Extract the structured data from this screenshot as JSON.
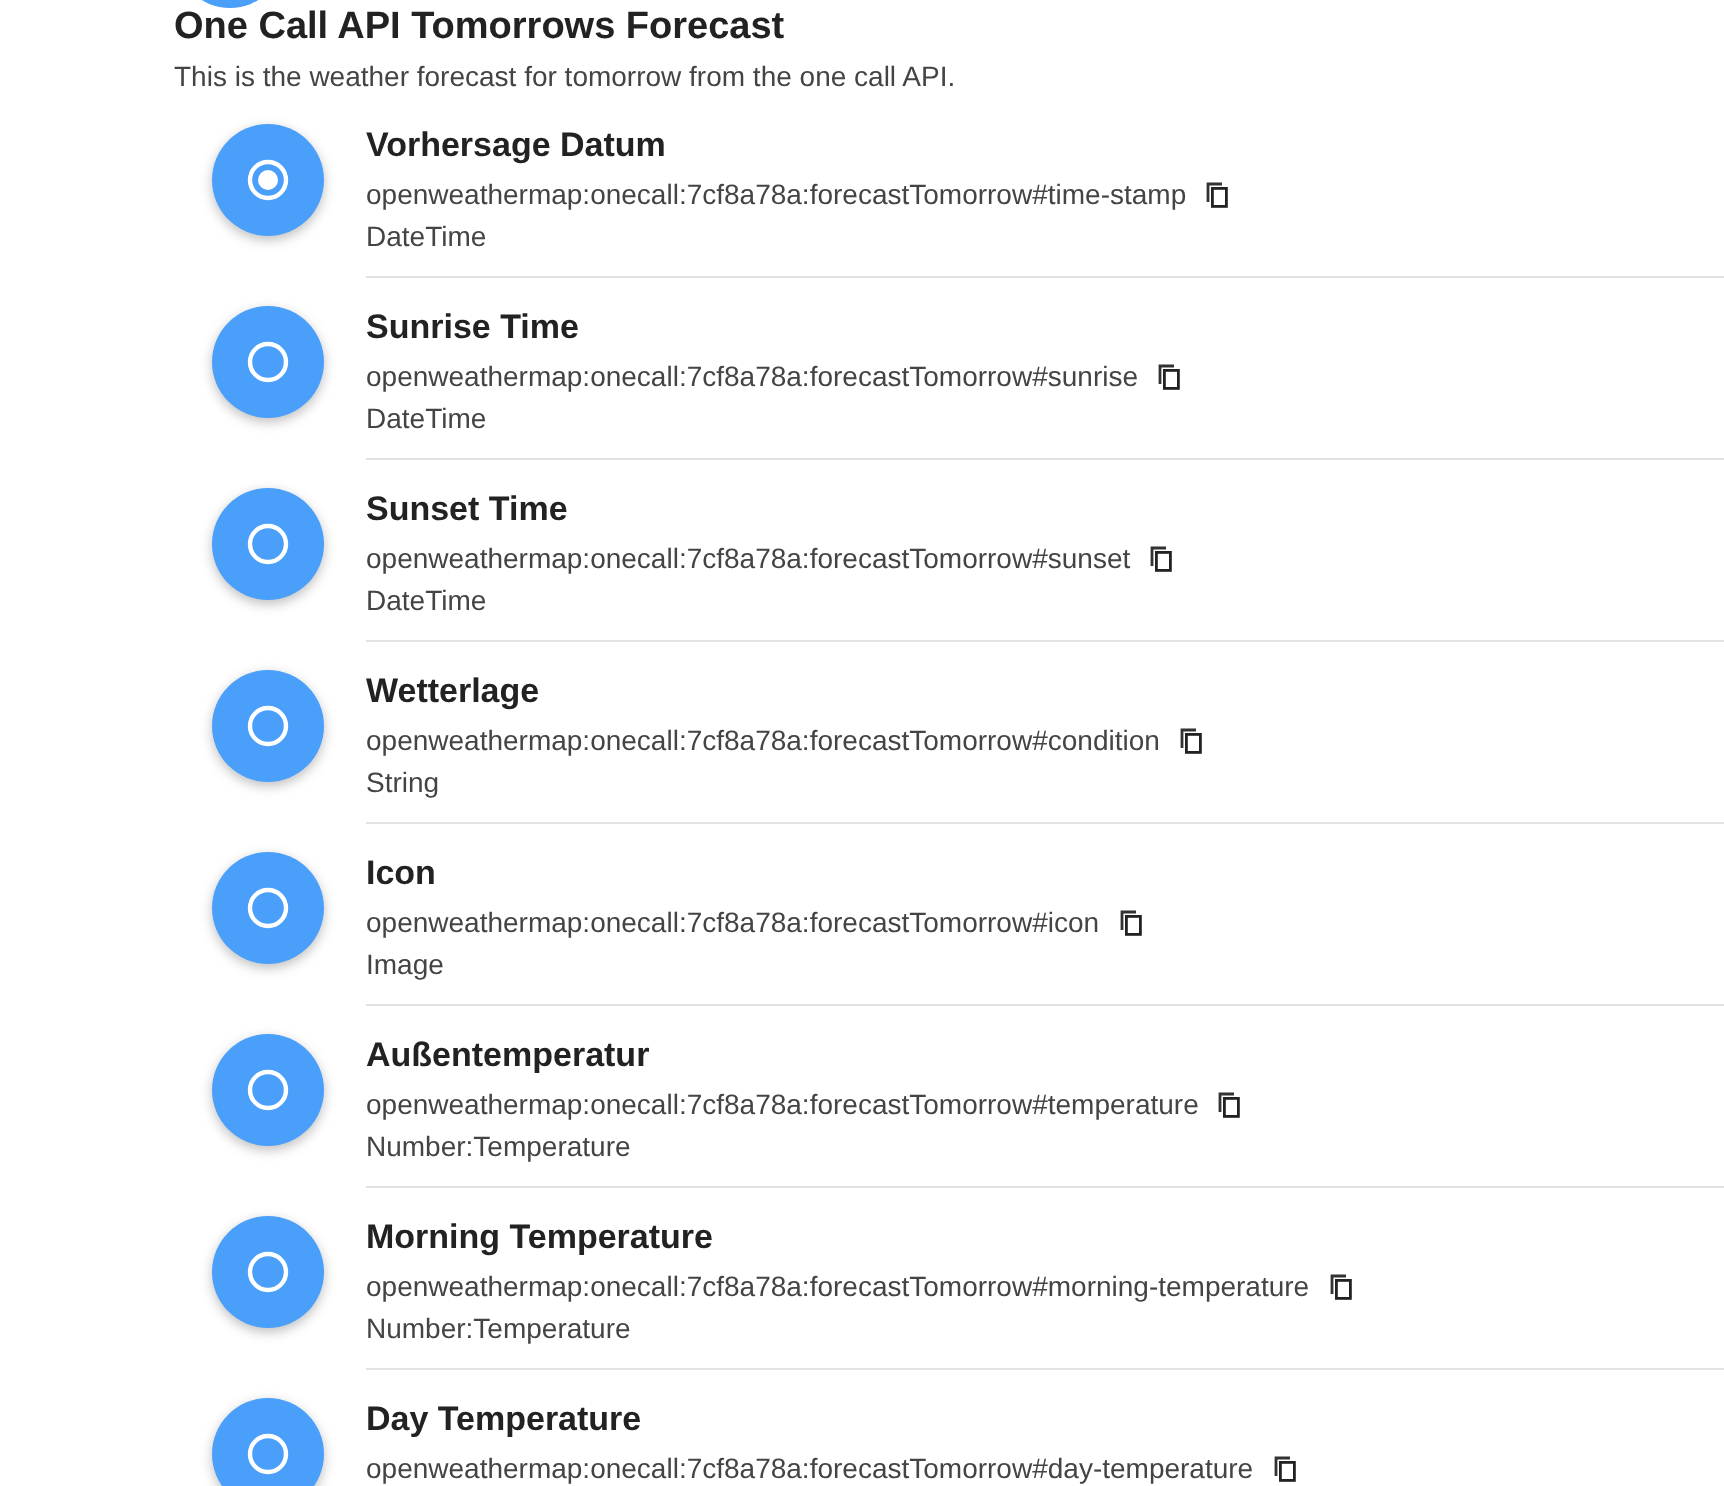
{
  "header": {
    "title": "One Call API Tomorrows Forecast",
    "description": "This is the weather forecast for tomorrow from the one call API."
  },
  "channels": [
    {
      "label": "Vorhersage Datum",
      "uid": "openweathermap:onecall:7cf8a78a:forecastTomorrow#time-stamp",
      "type": "DateTime",
      "linked": true
    },
    {
      "label": "Sunrise Time",
      "uid": "openweathermap:onecall:7cf8a78a:forecastTomorrow#sunrise",
      "type": "DateTime",
      "linked": false
    },
    {
      "label": "Sunset Time",
      "uid": "openweathermap:onecall:7cf8a78a:forecastTomorrow#sunset",
      "type": "DateTime",
      "linked": false
    },
    {
      "label": "Wetterlage",
      "uid": "openweathermap:onecall:7cf8a78a:forecastTomorrow#condition",
      "type": "String",
      "linked": false
    },
    {
      "label": "Icon",
      "uid": "openweathermap:onecall:7cf8a78a:forecastTomorrow#icon",
      "type": "Image",
      "linked": false
    },
    {
      "label": "Außentemperatur",
      "uid": "openweathermap:onecall:7cf8a78a:forecastTomorrow#temperature",
      "type": "Number:Temperature",
      "linked": false
    },
    {
      "label": "Morning Temperature",
      "uid": "openweathermap:onecall:7cf8a78a:forecastTomorrow#morning-temperature",
      "type": "Number:Temperature",
      "linked": false
    },
    {
      "label": "Day Temperature",
      "uid": "openweathermap:onecall:7cf8a78a:forecastTomorrow#day-temperature",
      "linked": false
    }
  ]
}
